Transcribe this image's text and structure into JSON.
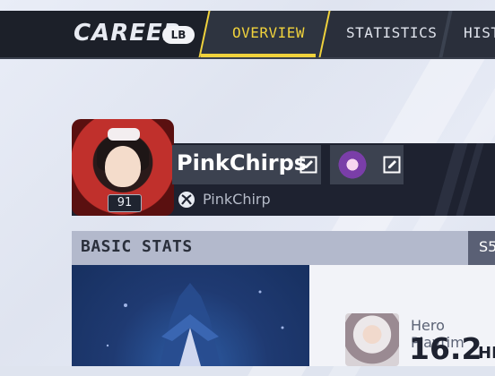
{
  "header": {
    "title": "CAREER",
    "badge": "LB",
    "tabs": [
      {
        "label": "OVERVIEW",
        "active": true
      },
      {
        "label": "STATISTICS",
        "active": false
      },
      {
        "label": "HISTO",
        "active": false
      }
    ]
  },
  "profile": {
    "name": "PinkChirps",
    "level": "91",
    "platform_name": "PinkChirp",
    "icons": [
      "edit-icon",
      "xbox-icon"
    ]
  },
  "basic_stats": {
    "title": "BASIC STATS",
    "season": "S5"
  },
  "hero_playtime": {
    "label": "Hero Playtim",
    "value": "16.2",
    "unit": "HR"
  },
  "colors": {
    "accent": "#f0d23c",
    "topbar": "#2a2f3b",
    "profile_bg": "#1e2230"
  }
}
